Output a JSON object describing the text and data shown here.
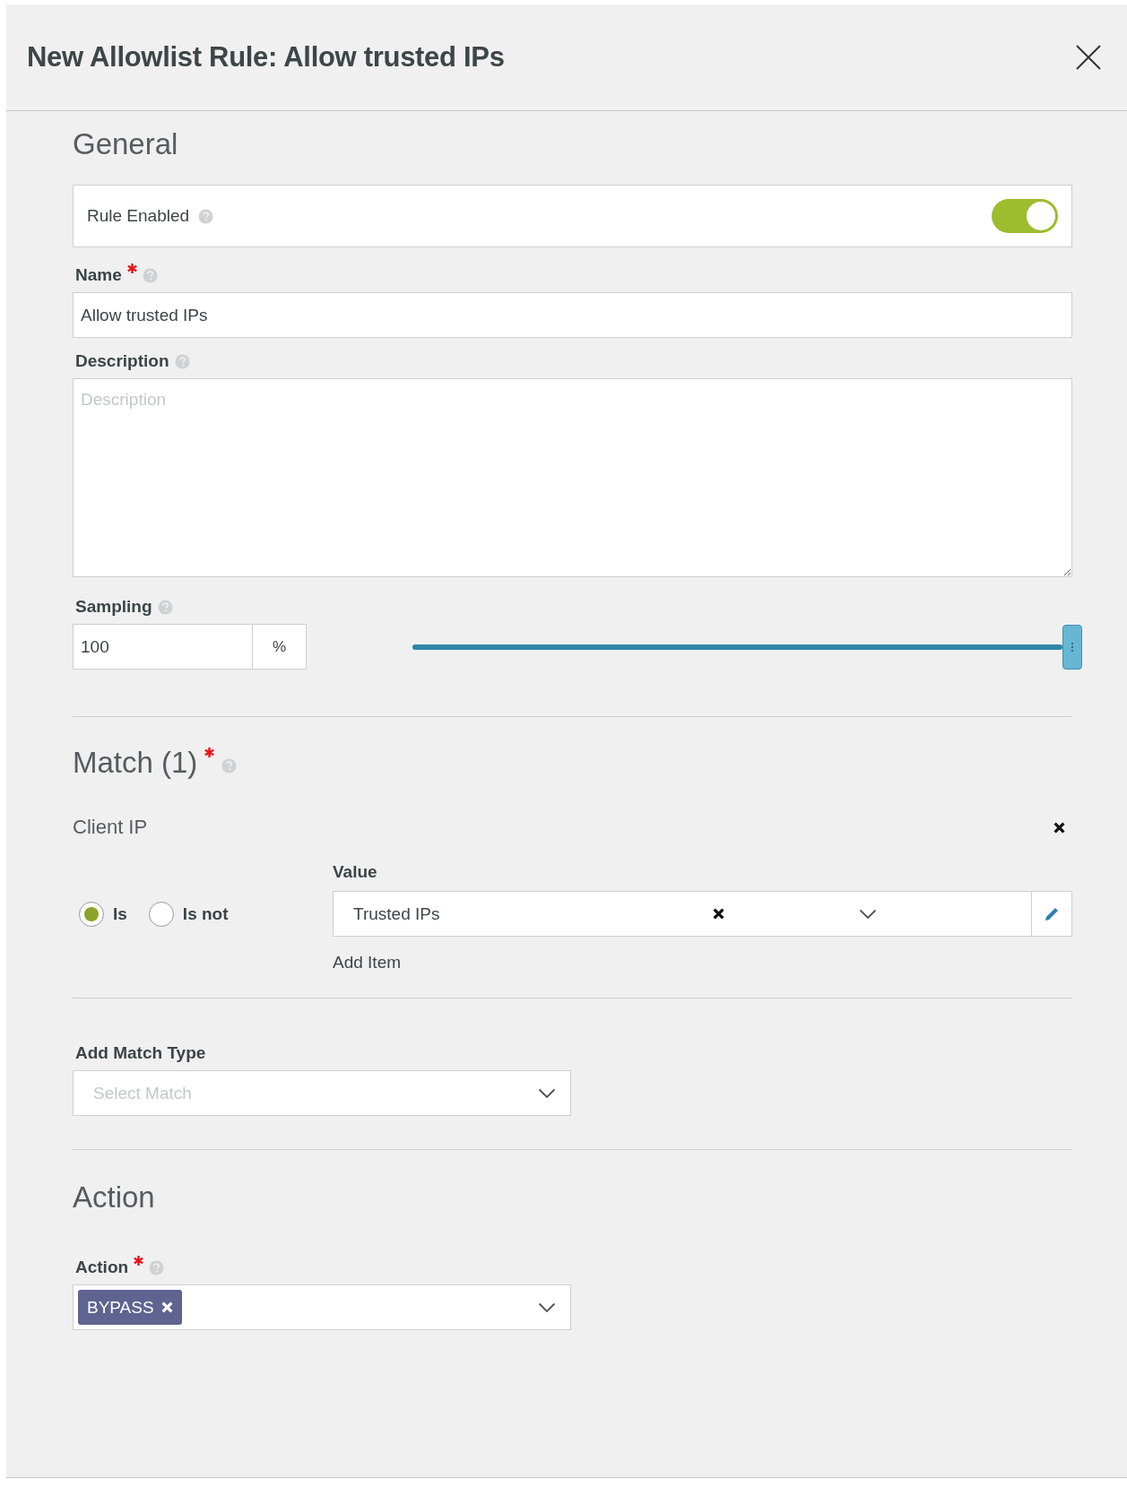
{
  "dialog": {
    "title": "New Allowlist Rule: Allow trusted IPs"
  },
  "general": {
    "heading": "General",
    "rule_enabled": {
      "label": "Rule Enabled",
      "on": true
    },
    "name": {
      "label": "Name",
      "required": true,
      "value": "Allow trusted IPs"
    },
    "description": {
      "label": "Description",
      "placeholder": "Description"
    },
    "sampling": {
      "label": "Sampling",
      "value": "100",
      "unit": "%",
      "level": 1
    }
  },
  "match": {
    "heading": "Match (1)",
    "required": true,
    "conditions": [
      {
        "label": "Client IP",
        "operators": [
          {
            "label": "Is",
            "selected": true
          },
          {
            "label": "Is not",
            "selected": false
          }
        ],
        "value_label": "Value",
        "value": "Trusted IPs",
        "add_item": "Add Item"
      }
    ],
    "add_match_type": {
      "label": "Add Match Type",
      "placeholder": "Select Match"
    }
  },
  "action": {
    "heading": "Action",
    "field": {
      "label": "Action",
      "required": true,
      "tags": [
        "BYPASS"
      ]
    }
  }
}
